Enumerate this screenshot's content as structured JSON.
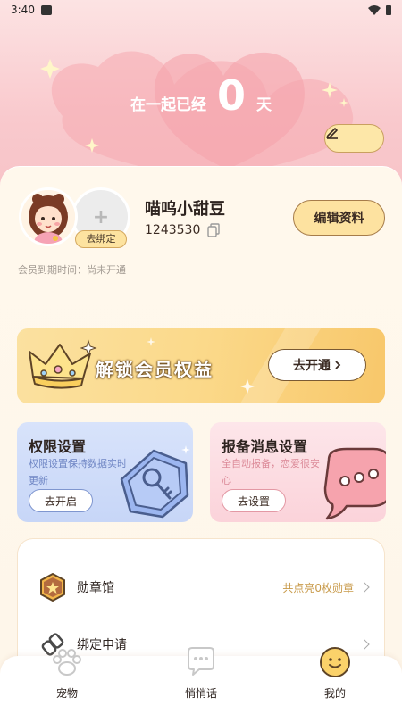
{
  "status_bar": {
    "time": "3:40"
  },
  "header": {
    "days_prefix": "在一起已经",
    "days_count": "0",
    "days_unit": "天",
    "edit_icon": "pencil-icon"
  },
  "profile": {
    "nickname": "喵呜小甜豆",
    "user_id": "1243530",
    "bind_label": "去绑定",
    "bind_plus": "+",
    "edit_button": "编辑资料",
    "member_expire": "会员到期时间：尚未开通"
  },
  "vip_banner": {
    "title": "解锁会员权益",
    "button": "去开通"
  },
  "feature_cards": {
    "permission": {
      "title": "权限设置",
      "desc": "权限设置保持数据实时更新",
      "button": "去开启"
    },
    "report": {
      "title": "报备消息设置",
      "desc": "全自动报备，恋爱很安心",
      "button": "去设置"
    }
  },
  "menu": {
    "items": [
      {
        "label": "勋章馆",
        "extra": "共点亮0枚勋章",
        "icon": "medal-icon"
      },
      {
        "label": "绑定申请",
        "extra": "",
        "icon": "link-icon"
      }
    ]
  },
  "tab_bar": {
    "tabs": [
      {
        "label": "宠物",
        "icon": "paw-icon"
      },
      {
        "label": "悄悄话",
        "icon": "chat-bubble-icon"
      },
      {
        "label": "我的",
        "icon": "smiley-icon"
      }
    ]
  },
  "colors": {
    "header_pink": "#f9c9cd",
    "card_bg": "#fff8ec",
    "gold": "#fbd98a",
    "perm_blue": "#c7d6f7",
    "report_pink": "#fbd3da",
    "accent_brown": "#a67c4a"
  }
}
